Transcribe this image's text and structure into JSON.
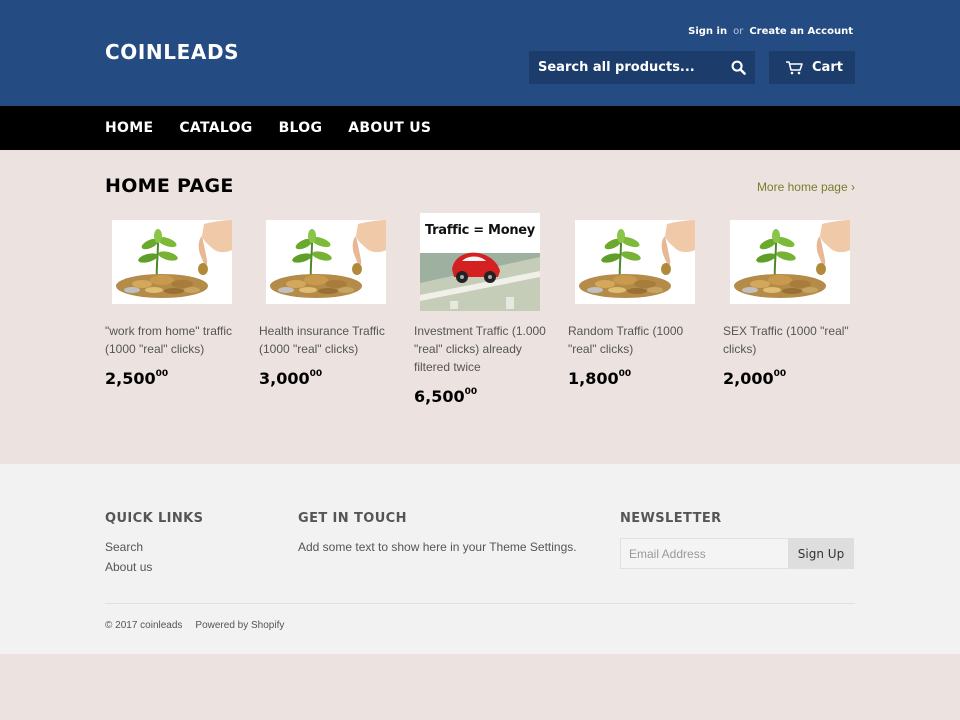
{
  "header": {
    "logo": "COINLEADS",
    "sign_in": "Sign in",
    "or": "or",
    "create_account": "Create an Account",
    "search_placeholder": "Search all products...",
    "cart": "Cart"
  },
  "nav": {
    "items": [
      "HOME",
      "CATALOG",
      "BLOG",
      "ABOUT US"
    ]
  },
  "main": {
    "title": "HOME PAGE",
    "more_link": "More home page ›",
    "products": [
      {
        "title": "\"work from home\" traffic (1000 \"real\" clicks)",
        "price": "2,500",
        "cents": "00",
        "image": "plant-coins"
      },
      {
        "title": "Health insurance Traffic (1000 \"real\" clicks)",
        "price": "3,000",
        "cents": "00",
        "image": "plant-coins"
      },
      {
        "title": "Investment Traffic (1.000 \"real\" clicks) already filtered twice",
        "price": "6,500",
        "cents": "00",
        "image": "traffic-money",
        "image_text": "Traffic = Money"
      },
      {
        "title": "Random Traffic (1000 \"real\" clicks)",
        "price": "1,800",
        "cents": "00",
        "image": "plant-coins"
      },
      {
        "title": "SEX Traffic (1000 \"real\" clicks)",
        "price": "2,000",
        "cents": "00",
        "image": "plant-coins"
      }
    ]
  },
  "footer": {
    "quick_links_heading": "QUICK LINKS",
    "quick_links": [
      "Search",
      "About us"
    ],
    "get_in_touch_heading": "GET IN TOUCH",
    "get_in_touch_text": "Add some text to show here in your Theme Settings.",
    "newsletter_heading": "NEWSLETTER",
    "email_placeholder": "Email Address",
    "signup_label": "Sign Up",
    "copyright": "© 2017 coinleads",
    "powered_by": "Powered by Shopify"
  },
  "colors": {
    "header_bg": "#244b82",
    "nav_bg": "#000000",
    "page_bg": "#ece2e0",
    "footer_bg": "#f2f2f2",
    "link_accent": "#7b7c2a"
  }
}
